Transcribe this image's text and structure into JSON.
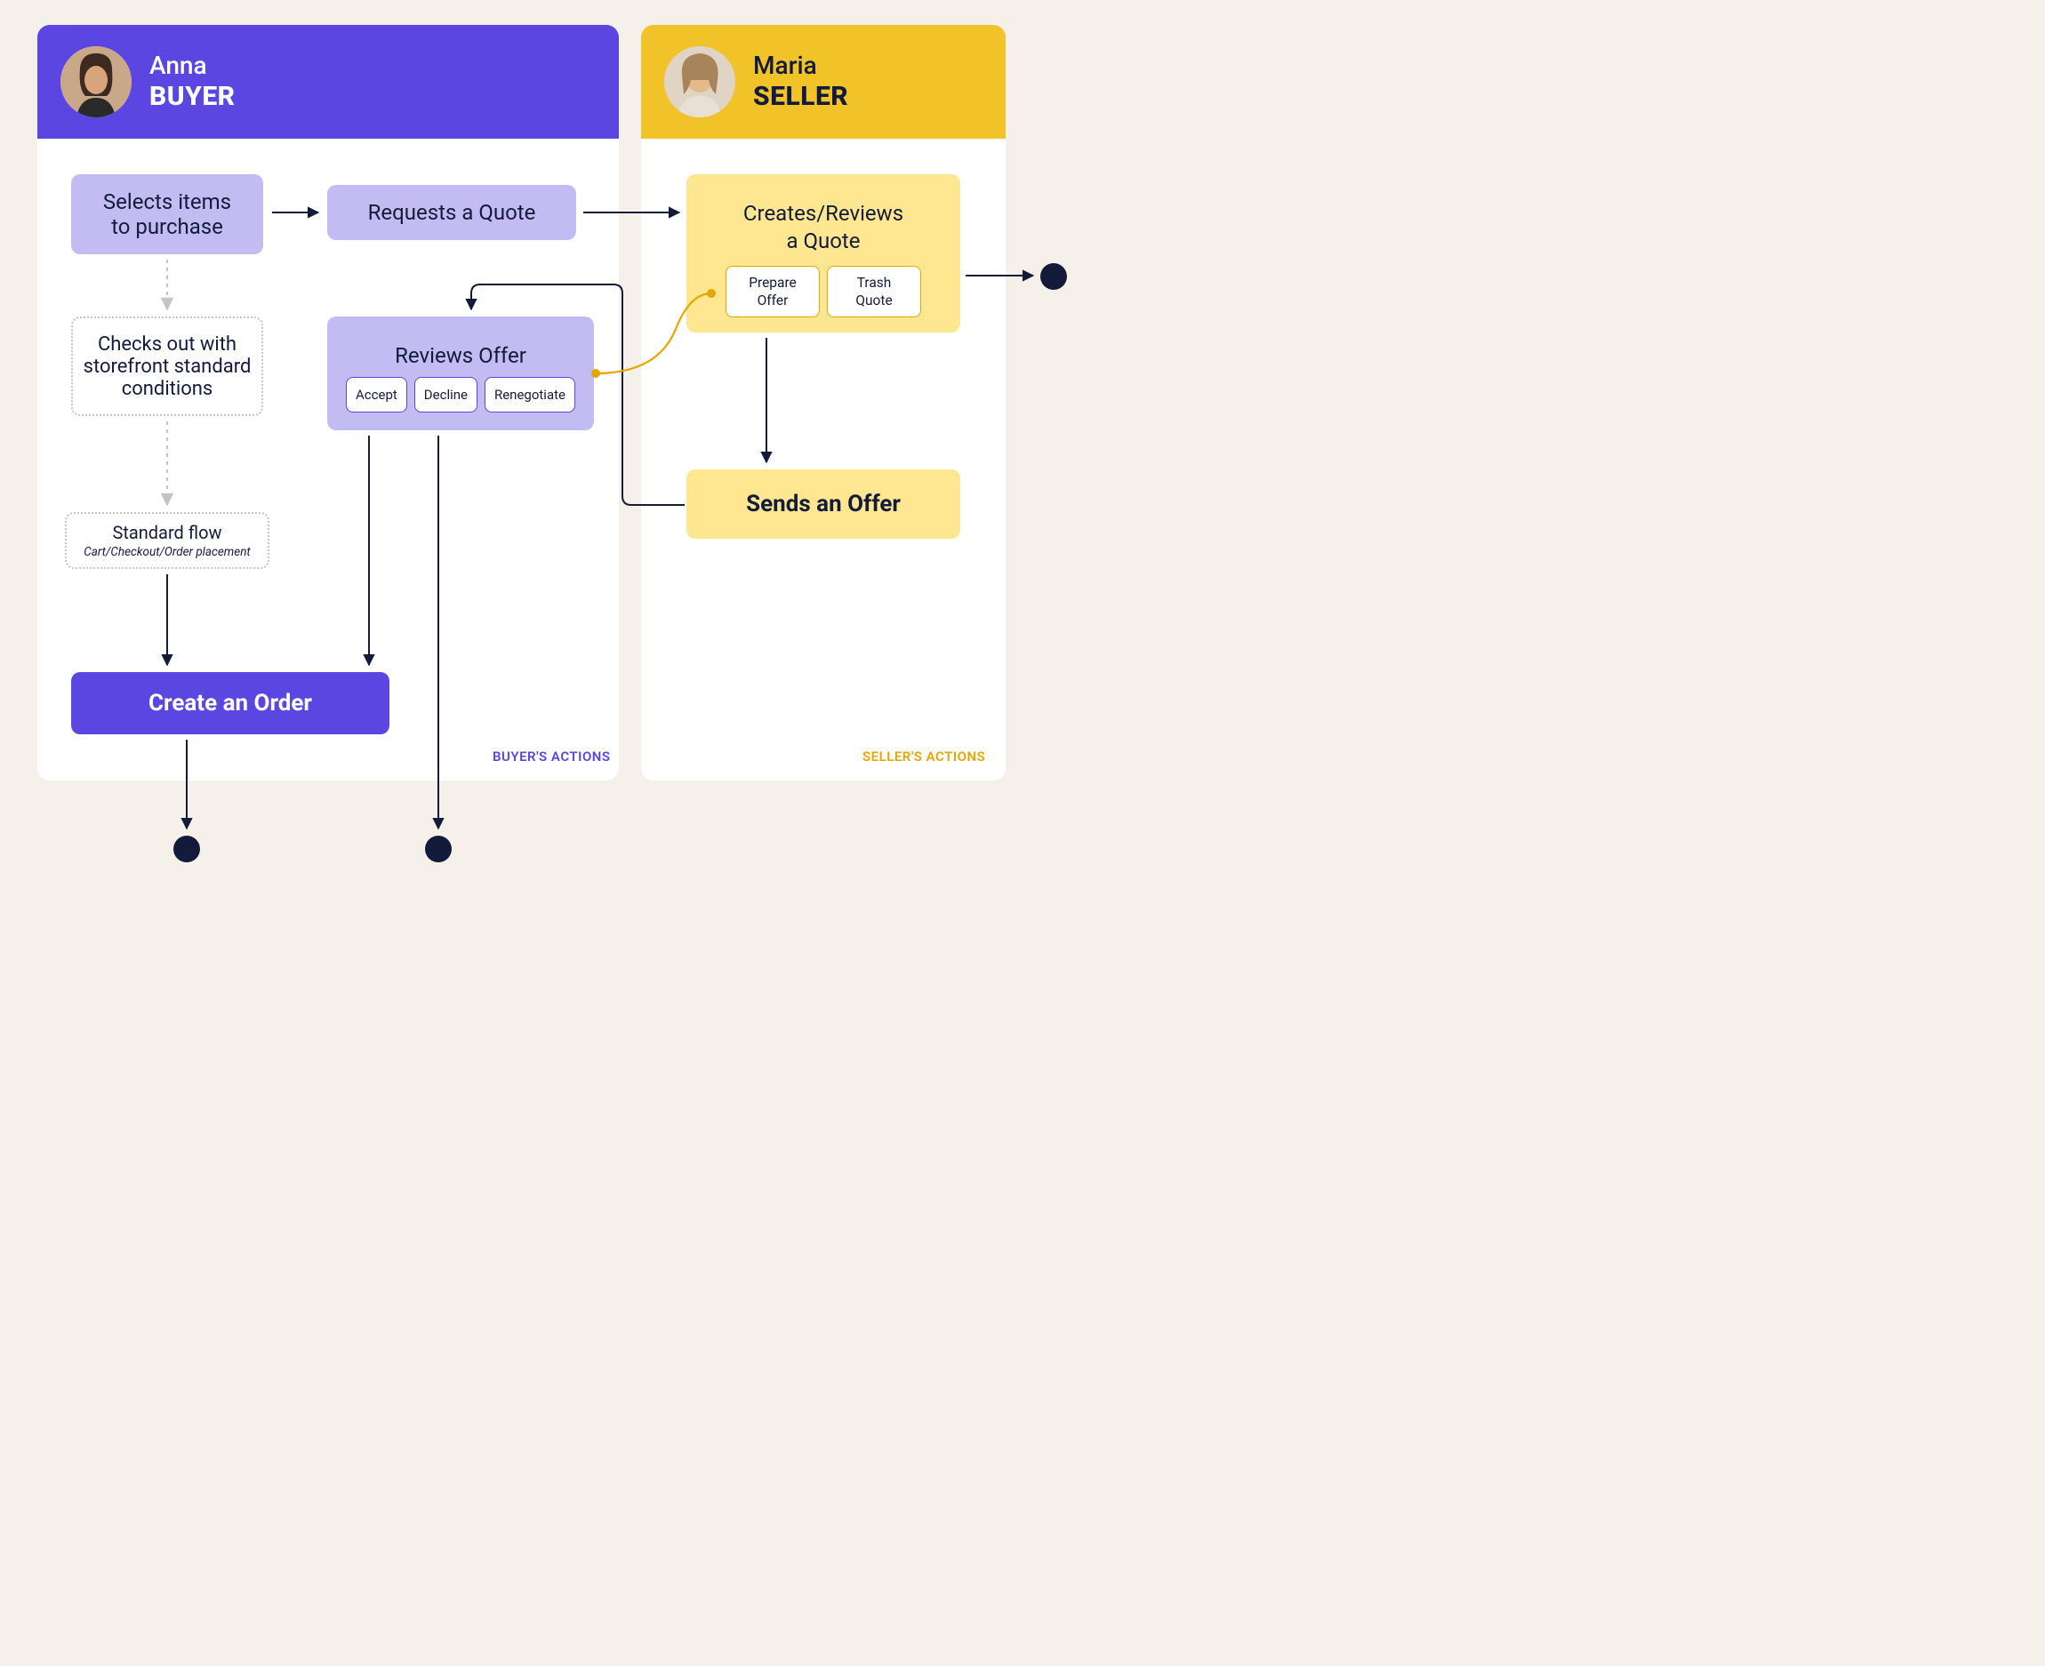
{
  "buyer": {
    "name": "Anna",
    "role": "BUYER",
    "footer": "BUYER'S ACTIONS"
  },
  "seller": {
    "name": "Maria",
    "role": "SELLER",
    "footer": "SELLER'S ACTIONS"
  },
  "nodes": {
    "select_items": "Selects items\nto purchase",
    "request_quote": "Requests a Quote",
    "checkout": "Checks out with storefront standard conditions",
    "standard_flow_title": "Standard flow",
    "standard_flow_sub": "Cart/Checkout/Order placement",
    "create_order": "Create an Order",
    "reviews_offer": "Reviews Offer",
    "accept": "Accept",
    "decline": "Decline",
    "renegotiate": "Renegotiate",
    "creates_quote": "Creates/Reviews\na Quote",
    "prepare_offer": "Prepare\nOffer",
    "trash_quote": "Trash\nQuote",
    "sends_offer": "Sends an Offer"
  }
}
